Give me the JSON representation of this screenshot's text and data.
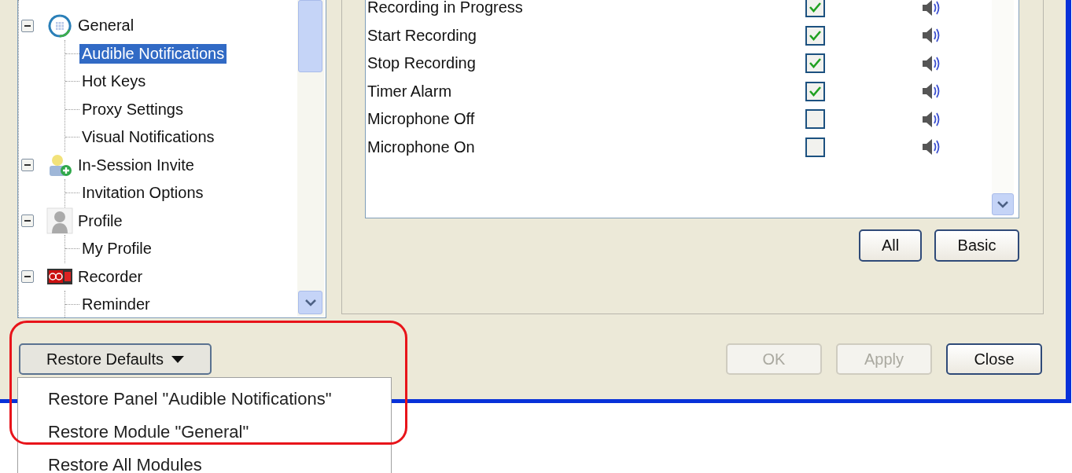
{
  "tree": [
    {
      "label": "General",
      "kind": "general",
      "expanded": true,
      "selected": false,
      "children": [
        {
          "label": "Audible Notifications",
          "selected": true
        },
        {
          "label": "Hot Keys",
          "selected": false
        },
        {
          "label": "Proxy Settings",
          "selected": false
        },
        {
          "label": "Visual Notifications",
          "selected": false
        }
      ]
    },
    {
      "label": "In-Session Invite",
      "kind": "invite",
      "expanded": true,
      "selected": false,
      "children": [
        {
          "label": "Invitation Options",
          "selected": false
        }
      ]
    },
    {
      "label": "Profile",
      "kind": "profile",
      "expanded": true,
      "selected": false,
      "children": [
        {
          "label": "My Profile",
          "selected": false
        }
      ]
    },
    {
      "label": "Recorder",
      "kind": "recorder",
      "expanded": true,
      "selected": false,
      "children": [
        {
          "label": "Reminder",
          "selected": false
        }
      ]
    }
  ],
  "notifications": [
    {
      "label": "Recording in Progress",
      "checked": true
    },
    {
      "label": "Start Recording",
      "checked": true
    },
    {
      "label": "Stop Recording",
      "checked": true
    },
    {
      "label": "Timer Alarm",
      "checked": true
    },
    {
      "label": "Microphone Off",
      "checked": false
    },
    {
      "label": "Microphone On",
      "checked": false
    }
  ],
  "list_buttons": [
    "All",
    "Basic"
  ],
  "restore_button": "Restore Defaults",
  "dialog_buttons": [
    {
      "label": "OK",
      "disabled": true
    },
    {
      "label": "Apply",
      "disabled": true
    },
    {
      "label": "Close",
      "disabled": false
    }
  ],
  "restore_menu": [
    "Restore Panel \"Audible Notifications\"",
    "Restore Module \"General\"",
    "Restore All Modules"
  ]
}
